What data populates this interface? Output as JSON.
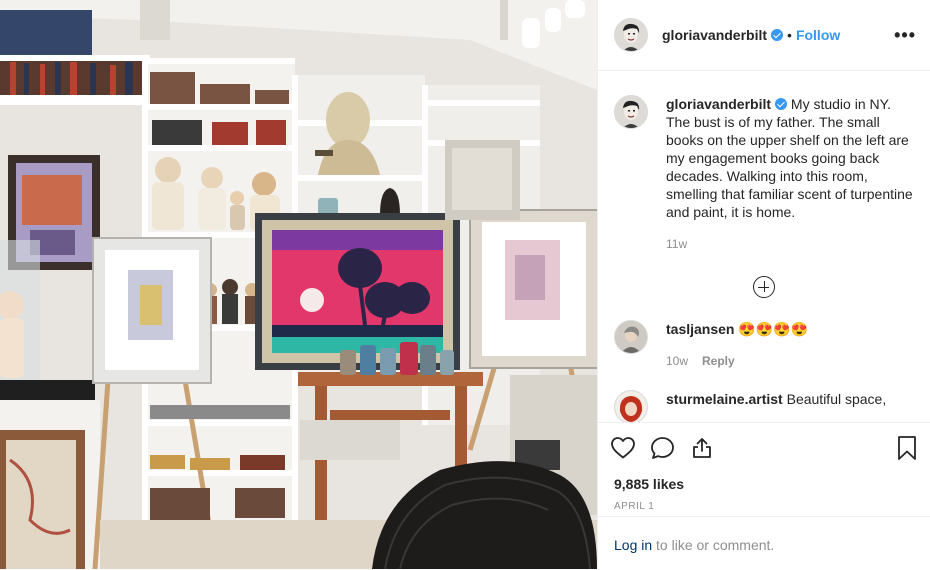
{
  "post": {
    "username": "gloriavanderbilt",
    "follow_label": "Follow",
    "separator": "•",
    "more_label": "•••"
  },
  "caption": {
    "username": "gloriavanderbilt",
    "text": "My studio in NY. The bust is of my father. The small books on the upper shelf on the left are my engagement books going back decades. Walking into this room, smelling that familiar scent of turpentine and paint, it is home.",
    "time": "11w"
  },
  "comments": [
    {
      "username": "tasljansen",
      "text": "😍😍😍😍",
      "time": "10w",
      "reply_label": "Reply"
    },
    {
      "username": "sturmelaine.artist",
      "text": "Beautiful space,",
      "time": "",
      "reply_label": ""
    }
  ],
  "footer": {
    "likes": "9,885 likes",
    "date": "APRIL 1",
    "login_link": "Log in",
    "login_rest": " to like or comment."
  },
  "colors": {
    "accent": "#3897f0",
    "muted": "#8e8e8e",
    "text": "#262626"
  },
  "icons": [
    "heart-icon",
    "comment-icon",
    "share-icon",
    "bookmark-icon",
    "plus-circle-icon",
    "verified-badge-icon",
    "more-options-icon"
  ]
}
